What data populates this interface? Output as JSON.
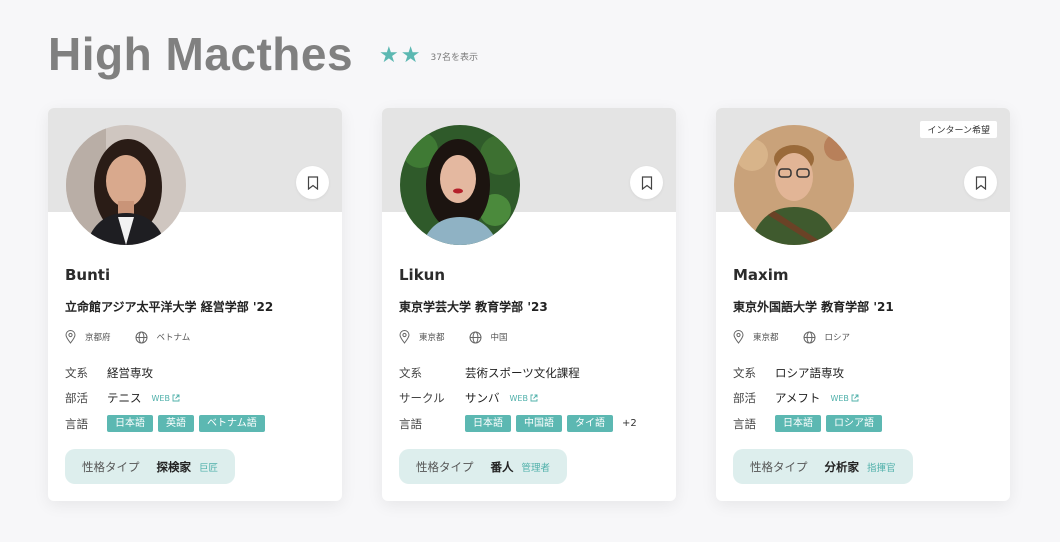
{
  "header": {
    "title": "High Macthes",
    "stars": 2,
    "count_text": "37名を表示"
  },
  "colors": {
    "accent": "#5cb8b2",
    "type_bg": "#ddeeed",
    "card_top": "#e4e4e4"
  },
  "labels": {
    "subject": "文系",
    "club": "部活",
    "circle": "サークル",
    "language": "言語",
    "personality": "性格タイプ",
    "web": "WEB"
  },
  "cards": [
    {
      "name": "Bunti",
      "school": "立命館アジア太平洋大学 経営学部 '22",
      "prefecture": "京都府",
      "country": "ベトナム",
      "subject": "経営専攻",
      "activity_label": "部活",
      "activity": "テニス",
      "languages": [
        "日本語",
        "英語",
        "ベトナム語"
      ],
      "more": "",
      "type": "探検家",
      "role": "巨匠",
      "badge": ""
    },
    {
      "name": "Likun",
      "school": "東京学芸大学 教育学部 '23",
      "prefecture": "東京都",
      "country": "中国",
      "subject": "芸術スポーツ文化課程",
      "activity_label": "サークル",
      "activity": "サンバ",
      "languages": [
        "日本語",
        "中国語",
        "タイ語"
      ],
      "more": "+2",
      "type": "番人",
      "role": "管理者",
      "badge": ""
    },
    {
      "name": "Maxim",
      "school": "東京外国語大学 教育学部 '21",
      "prefecture": "東京都",
      "country": "ロシア",
      "subject": "ロシア語専攻",
      "activity_label": "部活",
      "activity": "アメフト",
      "languages": [
        "日本語",
        "ロシア語"
      ],
      "more": "",
      "type": "分析家",
      "role": "指揮官",
      "badge": "インターン希望"
    }
  ]
}
